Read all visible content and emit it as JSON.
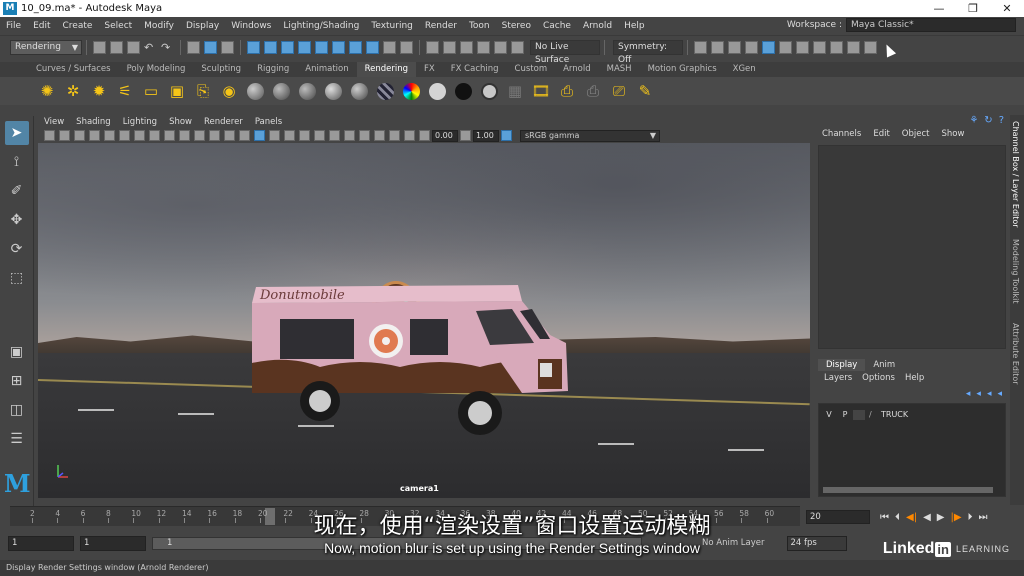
{
  "window": {
    "title": "10_09.ma* - Autodesk Maya",
    "logo": "M",
    "minimize": "—",
    "restore": "❐",
    "close": "✕"
  },
  "menubar": {
    "items": [
      "File",
      "Edit",
      "Create",
      "Select",
      "Modify",
      "Display",
      "Windows",
      "Lighting/Shading",
      "Texturing",
      "Render",
      "Toon",
      "Stereo",
      "Cache",
      "Arnold",
      "Help"
    ],
    "workspace_label": "Workspace :",
    "workspace_value": "Maya Classic*"
  },
  "statusline": {
    "menuset": "Rendering",
    "live_surface": "No Live Surface",
    "symmetry": "Symmetry: Off"
  },
  "shelf": {
    "tabs": [
      "Curves / Surfaces",
      "Poly Modeling",
      "Sculpting",
      "Rigging",
      "Animation",
      "Rendering",
      "FX",
      "FX Caching",
      "Custom",
      "Arnold",
      "MASH",
      "Motion Graphics",
      "XGen"
    ],
    "active_tab": "Rendering",
    "ball_colors": [
      "#888888",
      "#777777",
      "#7a7a7a",
      "#999999",
      "#8a8a8a",
      "#d4d4d4",
      "#111111",
      "#c8c8c8"
    ]
  },
  "viewport": {
    "menu": [
      "View",
      "Shading",
      "Lighting",
      "Show",
      "Renderer",
      "Panels"
    ],
    "exposure": "0.00",
    "gamma": "1.00",
    "colorspace": "sRGB gamma",
    "camera": "camera1",
    "truck_sign": "Donutmobile"
  },
  "channel_box": {
    "menu": [
      "Channels",
      "Edit",
      "Object",
      "Show"
    ],
    "side_tabs": [
      "Channel Box / Layer Editor",
      "Modeling Toolkit",
      "Attribute Editor"
    ]
  },
  "layer_editor": {
    "tabs": [
      "Display",
      "Anim"
    ],
    "menu": [
      "Layers",
      "Options",
      "Help"
    ],
    "layer": {
      "v": "V",
      "p": "P",
      "name": "TRUCK"
    }
  },
  "timeline": {
    "ticks": [
      "2",
      "4",
      "6",
      "8",
      "10",
      "12",
      "14",
      "16",
      "18",
      "20",
      "22",
      "24",
      "26",
      "28",
      "30",
      "32",
      "34",
      "36",
      "38",
      "40",
      "42",
      "44",
      "46",
      "48",
      "50",
      "52",
      "54",
      "56",
      "58",
      "60"
    ],
    "current_frame": "20"
  },
  "range": {
    "start": "1",
    "anim_start": "1",
    "slider_start": "1",
    "anim_layer": "No Anim Layer",
    "fps": "24 fps"
  },
  "helpline": "Display Render Settings window (Arnold Renderer)",
  "subtitles": {
    "cn": "现在，使用“渲染设置”窗口设置运动模糊",
    "en": "Now, motion blur is set up using the Render Settings window"
  },
  "brand": {
    "name": "Linked",
    "in": "in",
    "learning": "LEARNING"
  }
}
